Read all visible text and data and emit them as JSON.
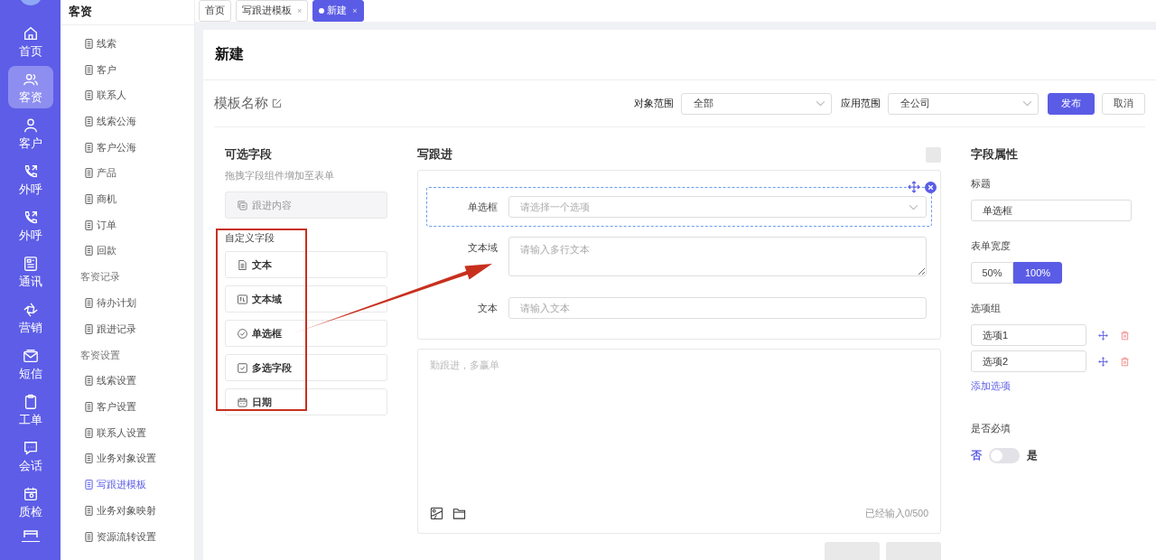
{
  "rail": {
    "items": [
      {
        "label": "首页",
        "selected": false
      },
      {
        "label": "客资",
        "selected": true
      },
      {
        "label": "客户",
        "selected": false
      },
      {
        "label": "外呼",
        "selected": false
      },
      {
        "label": "外呼",
        "selected": false
      },
      {
        "label": "通讯",
        "selected": false
      },
      {
        "label": "营销",
        "selected": false
      },
      {
        "label": "短信",
        "selected": false
      },
      {
        "label": "工单",
        "selected": false
      },
      {
        "label": "会话",
        "selected": false
      },
      {
        "label": "质检",
        "selected": false
      }
    ]
  },
  "sidebar": {
    "title": "客资",
    "sections": [
      {
        "items": [
          {
            "label": "线索",
            "selected": false
          },
          {
            "label": "客户",
            "selected": false
          },
          {
            "label": "联系人",
            "selected": false
          },
          {
            "label": "线索公海",
            "selected": false
          },
          {
            "label": "客户公海",
            "selected": false
          },
          {
            "label": "产品",
            "selected": false
          },
          {
            "label": "商机",
            "selected": false
          },
          {
            "label": "订单",
            "selected": false
          },
          {
            "label": "回款",
            "selected": false
          }
        ]
      },
      {
        "title": "客资记录",
        "items": [
          {
            "label": "待办计划",
            "selected": false
          },
          {
            "label": "跟进记录",
            "selected": false
          }
        ]
      },
      {
        "title": "客资设置",
        "items": [
          {
            "label": "线索设置",
            "selected": false
          },
          {
            "label": "客户设置",
            "selected": false
          },
          {
            "label": "联系人设置",
            "selected": false
          },
          {
            "label": "业务对象设置",
            "selected": false
          },
          {
            "label": "写跟进模板",
            "selected": true
          },
          {
            "label": "业务对象映射",
            "selected": false
          },
          {
            "label": "资源流转设置",
            "selected": false
          }
        ]
      }
    ]
  },
  "tabs": {
    "close_glyph": "×",
    "items": [
      {
        "label": "首页",
        "closable": false,
        "selected": false
      },
      {
        "label": "写跟进模板",
        "closable": true,
        "selected": false
      },
      {
        "label": "新建",
        "closable": true,
        "selected": true
      }
    ]
  },
  "page_title": "新建",
  "toolbar": {
    "template_name": "模板名称",
    "object_scope": {
      "label": "对象范围",
      "value": "全部"
    },
    "apply_scope": {
      "label": "应用范围",
      "value": "全公司"
    },
    "publish": "发布",
    "cancel": "取消"
  },
  "palette": {
    "title": "可选字段",
    "hint": "拖拽字段组件增加至表单",
    "fixed_field": "跟进内容",
    "custom_title": "自定义字段",
    "fields": [
      "文本",
      "文本域",
      "单选框",
      "多选字段",
      "日期"
    ]
  },
  "form": {
    "title": "写跟进",
    "fields": [
      {
        "kind": "select",
        "label": "单选框",
        "placeholder": "请选择一个选项",
        "selected": true
      },
      {
        "kind": "textarea",
        "label": "文本域",
        "placeholder": "请输入多行文本",
        "selected": false
      },
      {
        "kind": "input",
        "label": "文本",
        "placeholder": "请输入文本",
        "selected": false
      }
    ],
    "editor": {
      "placeholder": "勤跟进，多赢单",
      "counter": "已经输入0/500"
    }
  },
  "properties": {
    "title": "字段属性",
    "title_label": "标题",
    "title_value": "单选框",
    "width_label": "表单宽度",
    "widths": [
      {
        "label": "50%",
        "selected": false
      },
      {
        "label": "100%",
        "selected": true
      }
    ],
    "options_label": "选项组",
    "options": [
      "选项1",
      "选项2"
    ],
    "add_option": "添加选项",
    "required": {
      "label": "是否必填",
      "off_label": "否",
      "on_label": "是",
      "on": false
    }
  }
}
